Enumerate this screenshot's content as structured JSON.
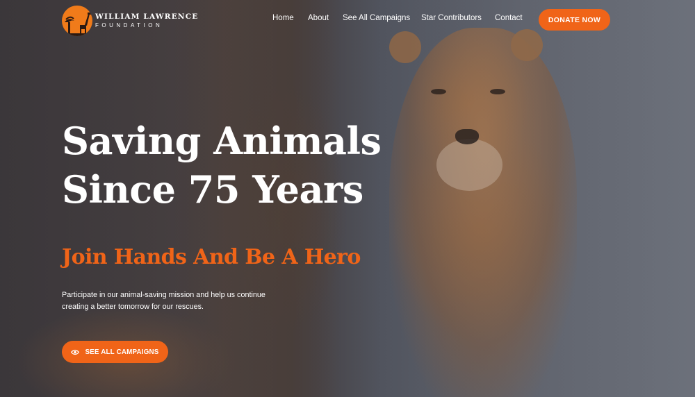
{
  "brand": {
    "name_line1": "WILLIAM LAWRENCE",
    "name_line2": "FOUNDATION",
    "logo_icon": "tree-giraffe-sunset-icon",
    "accent_color": "#f06418"
  },
  "nav": {
    "items": [
      {
        "label": "Home"
      },
      {
        "label": "About"
      },
      {
        "label": "See All Campaigns"
      },
      {
        "label": "Star Contributors"
      },
      {
        "label": "Contact"
      }
    ],
    "donate_label": "DONATE NOW"
  },
  "hero": {
    "title_line1": "Saving Animals",
    "title_line2": "Since 75 Years",
    "subtitle": "Join Hands And Be A Hero",
    "description": "Participate in our animal-saving mission and help us continue creating a better tomorrow for our rescues.",
    "cta_label": "SEE ALL CAMPAIGNS",
    "cta_icon": "eye-icon"
  }
}
